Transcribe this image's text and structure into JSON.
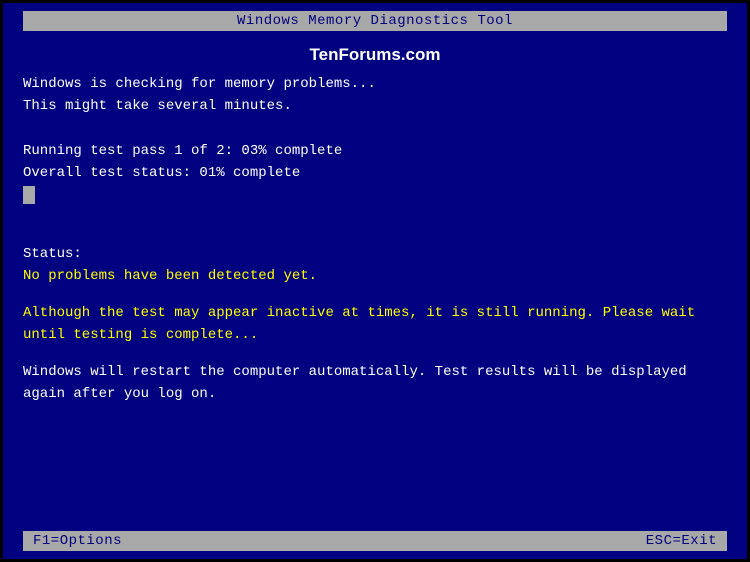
{
  "title": "Windows Memory Diagnostics Tool",
  "watermark": "TenForums.com",
  "checking_line1": "Windows is checking for memory problems...",
  "checking_line2": "This might take several minutes.",
  "test_pass": "Running test pass  1 of  2: 03% complete",
  "overall_status": "Overall test status: 01% complete",
  "status_label": "Status:",
  "status_message": "No problems have been detected yet.",
  "inactive_msg": "Although the test may appear inactive at times, it is still running. Please wait until testing is complete...",
  "restart_msg": "Windows will restart the computer automatically. Test results will be displayed again after you log on.",
  "footer_left": "F1=Options",
  "footer_right": "ESC=Exit"
}
